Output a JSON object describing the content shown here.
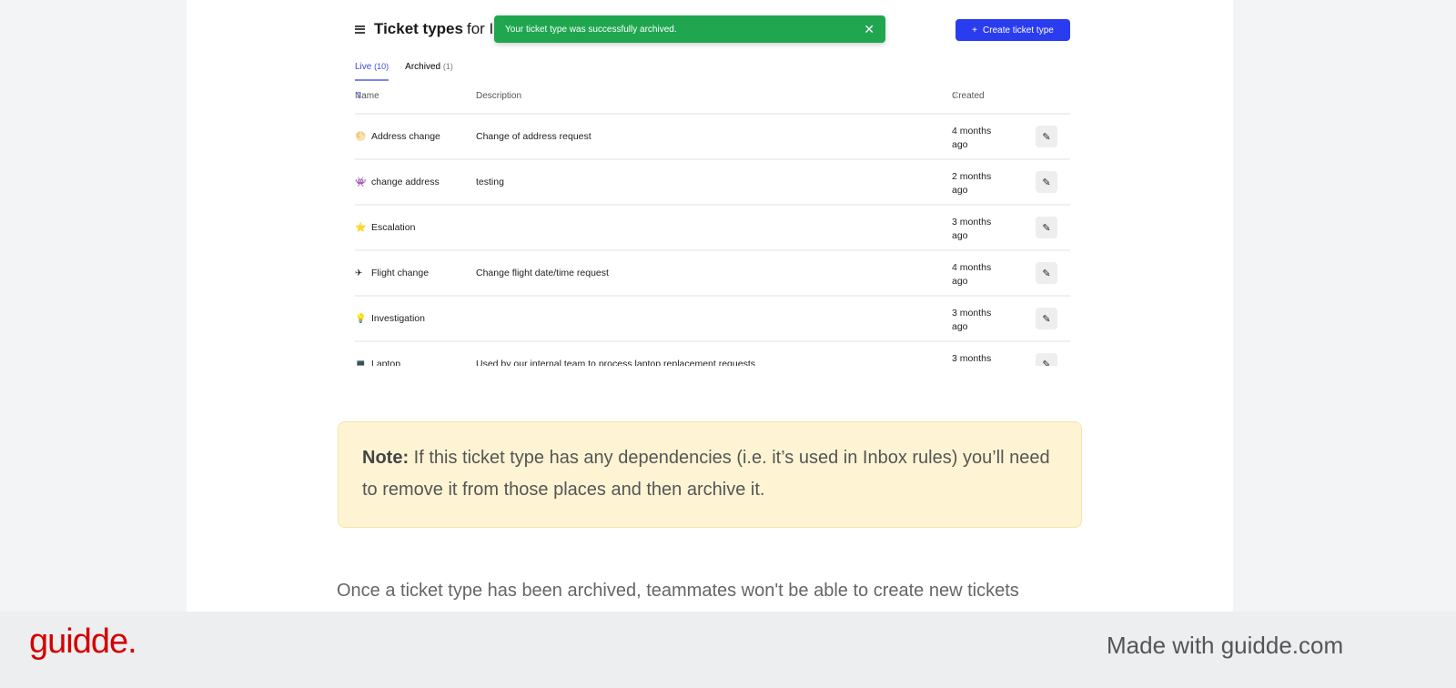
{
  "app": {
    "title": "Ticket types",
    "title_suffix": "for I",
    "create_label": "Create ticket type"
  },
  "toast": {
    "message": "Your ticket type was successfully archived.",
    "close": "✕"
  },
  "tabs": [
    {
      "label": "Live",
      "count": "(10)"
    },
    {
      "label": "Archived",
      "count": "(1)"
    }
  ],
  "columns": {
    "name": "Name",
    "description": "Description",
    "created": "Created"
  },
  "rows": [
    {
      "icon": "🌕",
      "name": "Address change",
      "description": "Change of address request",
      "created": "4 months ago"
    },
    {
      "icon": "👾",
      "name": "change address",
      "description": "testing",
      "created": "2 months ago"
    },
    {
      "icon": "⭐",
      "name": "Escalation",
      "description": "",
      "created": "3 months ago"
    },
    {
      "icon": "✈",
      "name": "Flight change",
      "description": "Change flight date/time request",
      "created": "4 months ago"
    },
    {
      "icon": "💡",
      "name": "Investigation",
      "description": "",
      "created": "3 months ago"
    },
    {
      "icon": "💻",
      "name": "Laptop",
      "description": "Used by our internal team to process laptop replacement requests",
      "created": "3 months"
    }
  ],
  "note": {
    "label": "Note:",
    "text": " If this ticket type has any dependencies (i.e. it’s used in Inbox rules) you’ll need to remove it from those places and then archive it."
  },
  "paragraph": "Once a ticket type has been archived, teammates won't be able to create new tickets",
  "footer": {
    "logo": "guidde.",
    "made_with": "Made with guidde.com"
  }
}
